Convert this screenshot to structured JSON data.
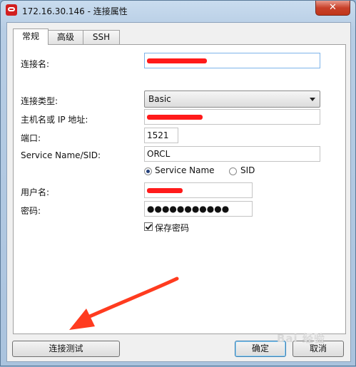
{
  "window": {
    "title": "172.16.30.146 - 连接属性",
    "close_glyph": "✕"
  },
  "tabs": [
    {
      "label": "常规",
      "active": true
    },
    {
      "label": "高级",
      "active": false
    },
    {
      "label": "SSH",
      "active": false
    }
  ],
  "form": {
    "connection_name": {
      "label": "连接名:",
      "value": ""
    },
    "connection_type": {
      "label": "连接类型:",
      "value": "Basic"
    },
    "host": {
      "label": "主机名或 IP 地址:",
      "value": ""
    },
    "port": {
      "label": "端口:",
      "value": "1521"
    },
    "service": {
      "label": "Service Name/SID:",
      "value": "ORCL"
    },
    "radio_service_name": {
      "label": "Service Name",
      "selected": true
    },
    "radio_sid": {
      "label": "SID",
      "selected": false
    },
    "username": {
      "label": "用户名:",
      "value": ""
    },
    "password": {
      "label": "密码:",
      "value": "●●●●●●●●●●●"
    },
    "save_password": {
      "label": "保存密码",
      "checked": true
    }
  },
  "buttons": {
    "test_connection": "连接测试",
    "ok": "确定",
    "cancel": "取消"
  },
  "annotation": {
    "arrow_color": "#ff3b1f"
  },
  "watermark": "Bai 经验",
  "colors": {
    "redaction": "#ff1a1a",
    "accent": "#3c7fb1"
  }
}
